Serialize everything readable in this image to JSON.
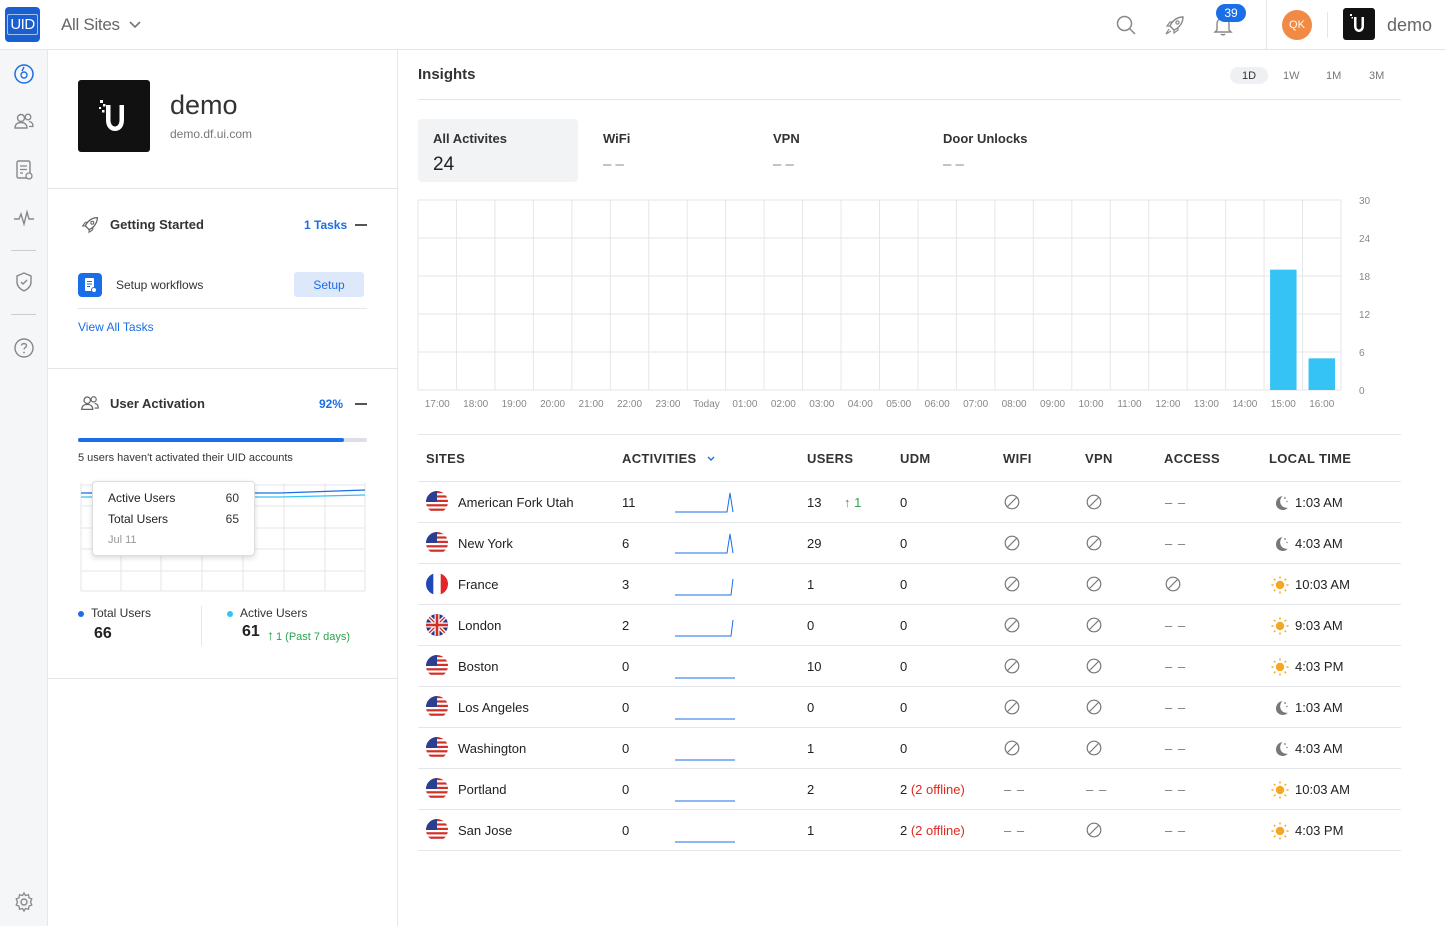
{
  "header": {
    "logo_text": "UID",
    "site_selector": "All Sites",
    "notification_count": "39",
    "user_initials": "QK",
    "account_name": "demo"
  },
  "org": {
    "name": "demo",
    "domain": "demo.df.ui.com"
  },
  "getting_started": {
    "title": "Getting Started",
    "tasks_label": "1 Tasks",
    "task_label": "Setup workflows",
    "setup_button": "Setup",
    "view_all": "View All Tasks"
  },
  "user_activation": {
    "title": "User Activation",
    "percent_label": "92%",
    "percent": 0.92,
    "message": "5 users haven't activated their UID accounts",
    "tooltip": {
      "active_label": "Active Users",
      "active_value": "60",
      "total_label": "Total Users",
      "total_value": "65",
      "date": "Jul 11"
    },
    "total_users_label": "Total Users",
    "total_users_value": "66",
    "active_users_label": "Active Users",
    "active_users_value": "61",
    "active_change": "1 (Past 7 days)"
  },
  "insights": {
    "title": "Insights",
    "ranges": [
      "1D",
      "1W",
      "1M",
      "3M"
    ],
    "active_range": "1D",
    "stats": [
      {
        "label": "All Activites",
        "value": "24"
      },
      {
        "label": "WiFi",
        "value": "– –"
      },
      {
        "label": "VPN",
        "value": "– –"
      },
      {
        "label": "Door Unlocks",
        "value": "– –"
      }
    ]
  },
  "chart_data": {
    "type": "bar",
    "categories": [
      "17:00",
      "18:00",
      "19:00",
      "20:00",
      "21:00",
      "22:00",
      "23:00",
      "Today",
      "01:00",
      "02:00",
      "03:00",
      "04:00",
      "05:00",
      "06:00",
      "07:00",
      "08:00",
      "09:00",
      "10:00",
      "11:00",
      "12:00",
      "13:00",
      "14:00",
      "15:00",
      "16:00"
    ],
    "values": [
      0,
      0,
      0,
      0,
      0,
      0,
      0,
      0,
      0,
      0,
      0,
      0,
      0,
      0,
      0,
      0,
      0,
      0,
      0,
      0,
      0,
      0,
      19,
      5
    ],
    "yticks": [
      0,
      6,
      12,
      18,
      24,
      30
    ],
    "ylim": [
      0,
      30
    ],
    "bar_color": "#34c3f4"
  },
  "table": {
    "headers": [
      "SITES",
      "ACTIVITIES",
      "USERS",
      "UDM",
      "WIFI",
      "VPN",
      "ACCESS",
      "LOCAL TIME"
    ],
    "rows": [
      {
        "site": "American Fork Utah",
        "flag": "us",
        "activities": "11",
        "spark": "spike",
        "users": "13",
        "users_change": "1",
        "udm": "0",
        "udm_offline": "",
        "wifi": "blocked",
        "vpn": "blocked",
        "access": "– –",
        "time": "1:03 AM",
        "time_icon": "moon"
      },
      {
        "site": "New York",
        "flag": "us",
        "activities": "6",
        "spark": "spike",
        "users": "29",
        "users_change": "",
        "udm": "0",
        "udm_offline": "",
        "wifi": "blocked",
        "vpn": "blocked",
        "access": "– –",
        "time": "4:03 AM",
        "time_icon": "moon"
      },
      {
        "site": "France",
        "flag": "fr",
        "activities": "3",
        "spark": "rise",
        "users": "1",
        "users_change": "",
        "udm": "0",
        "udm_offline": "",
        "wifi": "blocked",
        "vpn": "blocked",
        "access": "blocked",
        "time": "10:03 AM",
        "time_icon": "sun"
      },
      {
        "site": "London",
        "flag": "gb",
        "activities": "2",
        "spark": "rise",
        "users": "0",
        "users_change": "",
        "udm": "0",
        "udm_offline": "",
        "wifi": "blocked",
        "vpn": "blocked",
        "access": "– –",
        "time": "9:03 AM",
        "time_icon": "sun"
      },
      {
        "site": "Boston",
        "flag": "us",
        "activities": "0",
        "spark": "flat",
        "users": "10",
        "users_change": "",
        "udm": "0",
        "udm_offline": "",
        "wifi": "blocked",
        "vpn": "blocked",
        "access": "– –",
        "time": "4:03 PM",
        "time_icon": "sun"
      },
      {
        "site": "Los Angeles",
        "flag": "us",
        "activities": "0",
        "spark": "flat",
        "users": "0",
        "users_change": "",
        "udm": "0",
        "udm_offline": "",
        "wifi": "blocked",
        "vpn": "blocked",
        "access": "– –",
        "time": "1:03 AM",
        "time_icon": "moon"
      },
      {
        "site": "Washington",
        "flag": "us",
        "activities": "0",
        "spark": "flat",
        "users": "1",
        "users_change": "",
        "udm": "0",
        "udm_offline": "",
        "wifi": "blocked",
        "vpn": "blocked",
        "access": "– –",
        "time": "4:03 AM",
        "time_icon": "moon"
      },
      {
        "site": "Portland",
        "flag": "us",
        "activities": "0",
        "spark": "flat",
        "users": "2",
        "users_change": "",
        "udm": "2",
        "udm_offline": "(2 offline)",
        "wifi": "– –",
        "vpn": "– –",
        "access": "– –",
        "time": "10:03 AM",
        "time_icon": "sun"
      },
      {
        "site": "San Jose",
        "flag": "us",
        "activities": "0",
        "spark": "flat",
        "users": "1",
        "users_change": "",
        "udm": "2",
        "udm_offline": "(2 offline)",
        "wifi": "– –",
        "vpn": "blocked",
        "access": "– –",
        "time": "4:03 PM",
        "time_icon": "sun"
      }
    ]
  },
  "colors": {
    "accent": "#1a6ee8",
    "bar": "#34c3f4",
    "offline": "#e0281e",
    "positive": "#2aa44f"
  }
}
